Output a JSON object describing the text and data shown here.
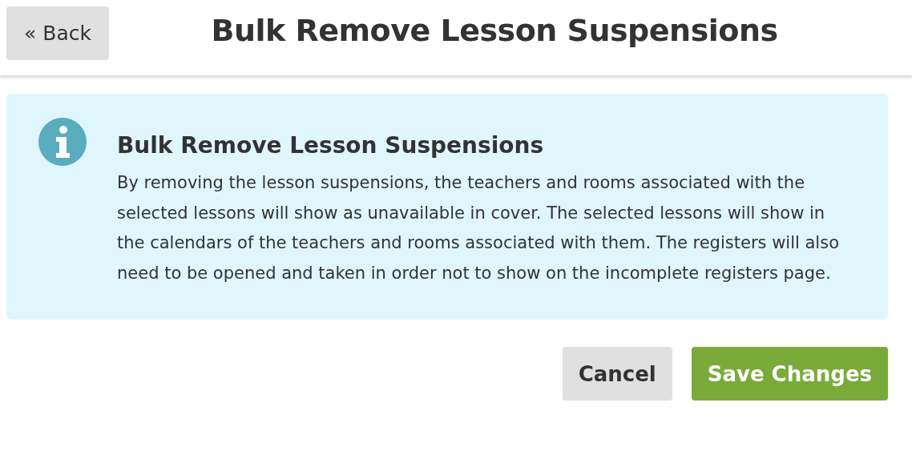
{
  "header": {
    "back_button": "« Back",
    "title": "Bulk Remove Lesson Suspensions"
  },
  "info_box": {
    "heading": "Bulk Remove Lesson Suspensions",
    "text": "By removing the lesson suspensions, the teachers and rooms associated with the selected lessons will show as unavailable in cover. The selected lessons will show in the calendars of the teachers and rooms associated with them. The registers will also need to be opened and taken in order not to show on the incomplete registers page."
  },
  "buttons": [
    {
      "label": "Cancel",
      "kind": "secondary"
    },
    {
      "label": "Save Changes",
      "kind": "primary"
    }
  ]
}
